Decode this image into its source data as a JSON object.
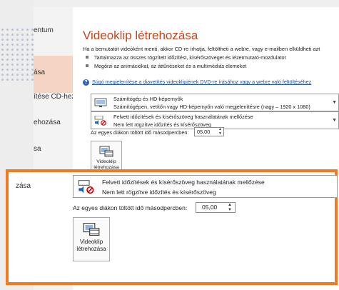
{
  "sidebar": {
    "items": [
      {
        "label": "entum"
      },
      {
        "label": "ása"
      },
      {
        "label": "ítése CD-hez"
      },
      {
        "label": "ehozása"
      },
      {
        "label": "sa"
      }
    ]
  },
  "main": {
    "title": "Videoklip létrehozása",
    "description": "Ha a bemutatót videóként menti, akkor CD-re írhatja, feltöltheti a webre, vagy e-mailben elküldheti azt",
    "bullets": [
      "Tartalmazza az összes rögzített időzítést, kísérőszöveget és lézermutató-mozdulatot",
      "Megőrzi az animációkat, az áttűnéseket és a multimédiás elemeket"
    ],
    "help_link": "Súgó megjelenítése a diavetítés videoklipjének DVD-re írásához vagy a webre való feltöltéséhez",
    "quality_combo": {
      "title": "Számítógép és HD-képernyők",
      "subtitle": "Számítógépen, vetítőn vagy HD-képernyőn való megjelenítésre (nagy – 1920 x 1080)"
    },
    "timing_combo": {
      "title": "Felvett időzítések és kísérőszöveg használatának mellőzése",
      "subtitle": "Nem lett rögzítve időzítés és kísérőszöveg"
    },
    "seconds_label": "Az egyes diákon töltött idő másodpercben:",
    "seconds_value": "05,00",
    "create_button": {
      "line1": "Videoklip",
      "line2": "létrehozása"
    }
  },
  "zoom": {
    "sidebar_label": "zása",
    "timing_title": "Felvett időzítések és kísérőszöveg használatának mellőzése",
    "timing_subtitle": "Nem lett rögzítve időzítés és kísérőszöveg",
    "seconds_label": "Az egyes diákon töltött idő másodpercben:",
    "seconds_value": "05,00",
    "create_button": {
      "line1": "Videoklip",
      "line2": "létrehozása"
    }
  },
  "colors": {
    "title": "#c4441c",
    "selected_sidebar": "#f6d4c4",
    "callout_border": "#f27a21",
    "link": "#1f4ea3"
  },
  "icons": [
    "monitor-icon",
    "timing-record-icon",
    "video-create-icon",
    "help-icon",
    "spin-arrows-icon",
    "dropdown-arrow-icon"
  ]
}
